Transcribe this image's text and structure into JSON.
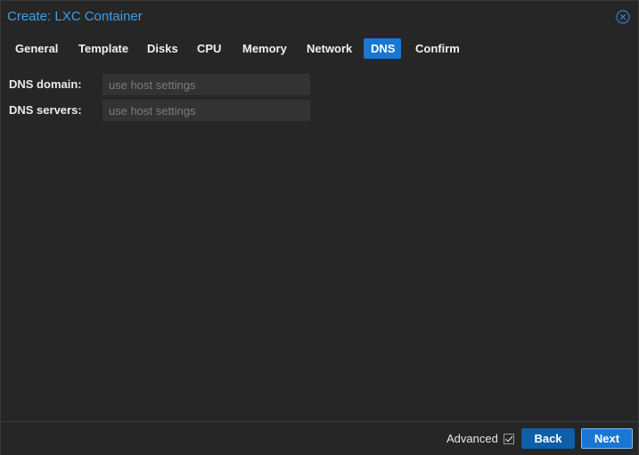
{
  "dialog": {
    "title": "Create: LXC Container",
    "close_icon": "close-circle-icon"
  },
  "tabs": [
    {
      "label": "General",
      "active": false
    },
    {
      "label": "Template",
      "active": false
    },
    {
      "label": "Disks",
      "active": false
    },
    {
      "label": "CPU",
      "active": false
    },
    {
      "label": "Memory",
      "active": false
    },
    {
      "label": "Network",
      "active": false
    },
    {
      "label": "DNS",
      "active": true
    },
    {
      "label": "Confirm",
      "active": false
    }
  ],
  "form": {
    "dns_domain": {
      "label": "DNS domain:",
      "value": "",
      "placeholder": "use host settings"
    },
    "dns_servers": {
      "label": "DNS servers:",
      "value": "",
      "placeholder": "use host settings"
    }
  },
  "footer": {
    "advanced_label": "Advanced",
    "advanced_checked": true,
    "back_label": "Back",
    "next_label": "Next"
  },
  "colors": {
    "accent": "#1976d2",
    "title": "#3f9fe8",
    "background": "#262626",
    "input_background": "#333333"
  }
}
